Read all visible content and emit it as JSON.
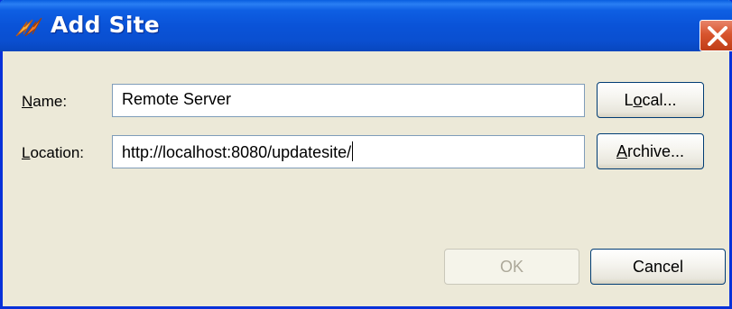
{
  "dialog": {
    "title": "Add Site",
    "close_icon": "close-icon",
    "app_icon": "plugin-lightning-icon"
  },
  "form": {
    "name_label": "Name:",
    "name_value": "Remote Server",
    "location_label": "Location:",
    "location_value": "http://localhost:8080/updatesite/"
  },
  "buttons": {
    "local": "Local...",
    "archive": "Archive...",
    "ok": "OK",
    "cancel": "Cancel"
  },
  "colors": {
    "title_bar": "#0a53d8",
    "close_button": "#d8552e",
    "dialog_background": "#ece9d8",
    "field_border": "#7f9db9"
  }
}
